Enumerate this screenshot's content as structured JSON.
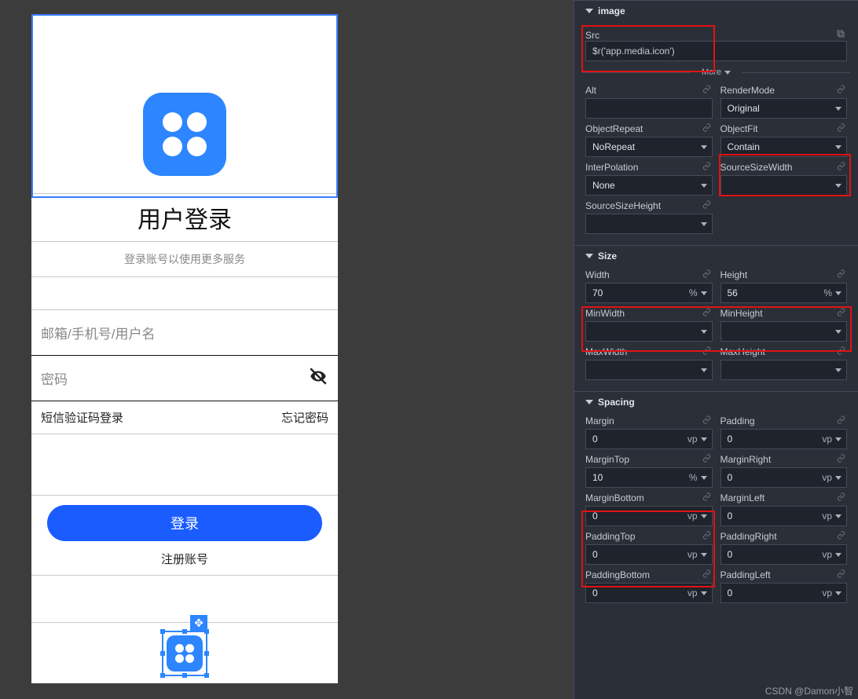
{
  "phone": {
    "title": "用户登录",
    "subtitle": "登录账号以使用更多服务",
    "email_placeholder": "邮箱/手机号/用户名",
    "password_placeholder": "密码",
    "sms_login": "短信验证码登录",
    "forgot": "忘记密码",
    "login_btn": "登录",
    "register": "注册账号"
  },
  "inspector": {
    "sections": {
      "image": "image",
      "size": "Size",
      "spacing": "Spacing"
    },
    "more": "More",
    "src": {
      "label": "Src",
      "value": "$r('app.media.icon')"
    },
    "alt": {
      "label": "Alt",
      "value": ""
    },
    "renderMode": {
      "label": "RenderMode",
      "value": "Original"
    },
    "objectRepeat": {
      "label": "ObjectRepeat",
      "value": "NoRepeat"
    },
    "objectFit": {
      "label": "ObjectFit",
      "value": "Contain"
    },
    "interpolation": {
      "label": "InterPolation",
      "value": "None"
    },
    "sourceSizeWidth": {
      "label": "SourceSizeWidth",
      "value": ""
    },
    "sourceSizeHeight": {
      "label": "SourceSizeHeight",
      "value": ""
    },
    "width": {
      "label": "Width",
      "value": "70",
      "unit": "%"
    },
    "height": {
      "label": "Height",
      "value": "56",
      "unit": "%"
    },
    "minWidth": {
      "label": "MinWidth",
      "value": ""
    },
    "minHeight": {
      "label": "MinHeight",
      "value": ""
    },
    "maxWidth": {
      "label": "MaxWidth",
      "value": ""
    },
    "maxHeight": {
      "label": "MaxHeight",
      "value": ""
    },
    "margin": {
      "label": "Margin",
      "value": "0",
      "unit": "vp"
    },
    "padding": {
      "label": "Padding",
      "value": "0",
      "unit": "vp"
    },
    "marginTop": {
      "label": "MarginTop",
      "value": "10",
      "unit": "%"
    },
    "marginRight": {
      "label": "MarginRight",
      "value": "0",
      "unit": "vp"
    },
    "marginBottom": {
      "label": "MarginBottom",
      "value": "0",
      "unit": "vp"
    },
    "marginLeft": {
      "label": "MarginLeft",
      "value": "0",
      "unit": "vp"
    },
    "paddingTop": {
      "label": "PaddingTop",
      "value": "0",
      "unit": "vp"
    },
    "paddingRight": {
      "label": "PaddingRight",
      "value": "0",
      "unit": "vp"
    },
    "paddingBottom": {
      "label": "PaddingBottom",
      "value": "0",
      "unit": "vp"
    },
    "paddingLeft": {
      "label": "PaddingLeft",
      "value": "0",
      "unit": "vp"
    }
  },
  "watermark": "CSDN @Damon小智"
}
